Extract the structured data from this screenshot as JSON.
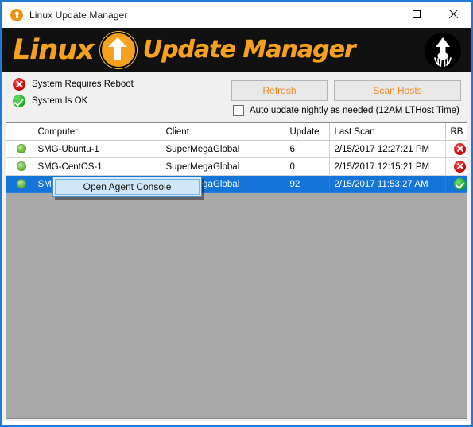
{
  "window": {
    "title": "Linux Update Manager",
    "title_icon": "orange-up-arrow-icon",
    "controls": {
      "minimize": "minimize-icon",
      "maximize": "maximize-icon",
      "close": "close-icon"
    }
  },
  "banner": {
    "word1": "Linux",
    "word2": "Update Manager",
    "center_icon": "orange-circle-up-arrow-icon",
    "right_logo": "squid-arrow-logo-icon",
    "background": "#111111",
    "text_color": "#f5a11f"
  },
  "status": {
    "items": [
      {
        "icon": "red-x-badge-icon",
        "label": "System Requires Reboot",
        "color": "#cc0000"
      },
      {
        "icon": "green-check-badge-icon",
        "label": "System Is OK",
        "color": "#1aa81a"
      }
    ]
  },
  "toolbar": {
    "refresh_label": "Refresh",
    "scan_hosts_label": "Scan Hosts",
    "button_text_color": "#f08a1e",
    "auto_update_label": "Auto update nightly as needed (12AM LTHost Time)",
    "auto_update_checked": false
  },
  "grid": {
    "columns": [
      "",
      "Computer",
      "Client",
      "Update",
      "Last Scan",
      "RB"
    ],
    "selection_color": "#1474d8",
    "body_background": "#a9a9a9",
    "rows": [
      {
        "status_dot": "green-dot-icon",
        "computer": "SMG-Ubuntu-1",
        "client": "SuperMegaGlobal",
        "update": "6",
        "last_scan": "2/15/2017 12:27:21 PM",
        "rb": "red-x-icon",
        "selected": false
      },
      {
        "status_dot": "green-dot-icon",
        "computer": "SMG-CentOS-1",
        "client": "SuperMegaGlobal",
        "update": "0",
        "last_scan": "2/15/2017 12:15:21 PM",
        "rb": "red-x-icon",
        "selected": false
      },
      {
        "status_dot": "green-dot-icon",
        "computer": "SMG-Mint-1",
        "client": "SuperMegaGlobal",
        "update": "92",
        "last_scan": "2/15/2017 11:53:27 AM",
        "rb": "green-check-icon",
        "selected": true
      }
    ]
  },
  "context_menu": {
    "items": [
      {
        "label": "Open Agent Console"
      }
    ]
  }
}
